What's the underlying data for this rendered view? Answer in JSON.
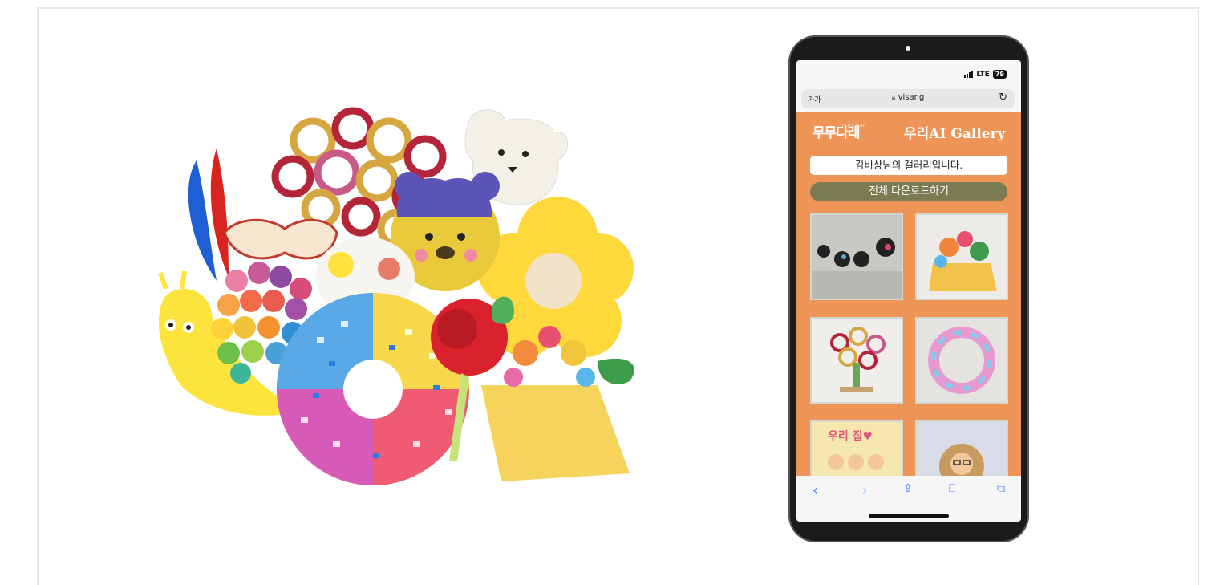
{
  "artwork": {
    "description_icon": "craft-collage-illustration"
  },
  "phone": {
    "status": {
      "network": "LTE",
      "battery": "79"
    },
    "browser": {
      "text_size_label": "가가",
      "url": "visang",
      "reload_icon": "reload-icon"
    },
    "site": {
      "logo_left": "무무다래",
      "logo_sub": "come with",
      "logo_right": "우리AI Gallery",
      "greeting": "김비상님의 갤러리입니다.",
      "download_all": "전체 다운로드하기"
    },
    "gallery": {
      "items": [
        "thumb-1",
        "thumb-2",
        "thumb-3",
        "thumb-4",
        "thumb-5",
        "thumb-6"
      ]
    },
    "toolbar": {
      "icons": [
        "back-icon",
        "forward-icon",
        "share-icon",
        "bookmarks-icon",
        "tabs-icon"
      ]
    }
  },
  "colors": {
    "page_bg": "#ee9456",
    "download_button": "#7a7b52",
    "link_blue": "#2f7df6"
  }
}
